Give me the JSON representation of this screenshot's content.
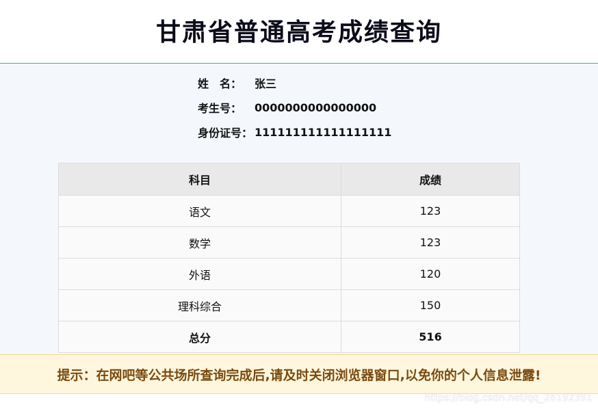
{
  "header": {
    "title": "甘肃省普通高考成绩查询"
  },
  "student": {
    "name_label": "姓　名：",
    "name_value": "张三",
    "exam_no_label": "考生号：",
    "exam_no_value": "0000000000000000",
    "id_label": "身份证号：",
    "id_value": "111111111111111111"
  },
  "table": {
    "headers": [
      "科目",
      "成绩"
    ],
    "rows": [
      {
        "subject": "语文",
        "score": "123"
      },
      {
        "subject": "数学",
        "score": "123"
      },
      {
        "subject": "外语",
        "score": "120"
      },
      {
        "subject": "理科综合",
        "score": "150"
      }
    ],
    "total": {
      "subject": "总分",
      "score": "516"
    }
  },
  "notice": {
    "text": "提示：在网吧等公共场所查询完成后,请及时关闭浏览器窗口,以免你的个人信息泄露!"
  },
  "watermark": {
    "text": "https://blog.csdn.net/qq_26192391"
  },
  "colors": {
    "header_border": "#5b9ea2",
    "notice_bg": "#fef7dd",
    "notice_text": "#7a4a10",
    "main_bg": "#f4f7fb"
  }
}
